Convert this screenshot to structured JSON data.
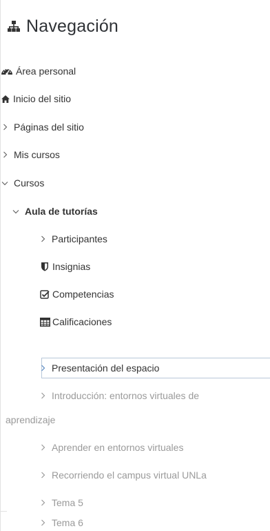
{
  "nav": {
    "title": "Navegación",
    "title_icon": "sitemap-icon",
    "items": [
      {
        "label": "Área personal",
        "icon": "dashboard-icon"
      },
      {
        "label": "Inicio del sitio",
        "icon": "home-icon"
      },
      {
        "label": "Páginas del sitio",
        "icon": "chevron-right-icon"
      },
      {
        "label": "Mis cursos",
        "icon": "chevron-right-icon"
      },
      {
        "label": "Cursos",
        "icon": "chevron-down-icon"
      },
      {
        "label": "Aula de tutorías",
        "icon": "chevron-down-icon"
      },
      {
        "label": "Participantes",
        "icon": "chevron-right-icon"
      },
      {
        "label": "Insignias",
        "icon": "shield-icon"
      },
      {
        "label": "Competencias",
        "icon": "checkbox-icon"
      },
      {
        "label": "Calificaciones",
        "icon": "table-icon"
      },
      {
        "label": "Presentación del espacio",
        "icon": "chevron-right-icon"
      },
      {
        "label": "Introducción: entornos virtuales de",
        "icon": "chevron-right-icon"
      },
      {
        "label": "aprendizaje"
      },
      {
        "label": "Aprender en entornos virtuales",
        "icon": "chevron-right-icon"
      },
      {
        "label": "Recorriendo el campus virtual UNLa",
        "icon": "chevron-right-icon"
      },
      {
        "label": "Tema 5",
        "icon": "chevron-right-icon"
      },
      {
        "label": "Tema 6",
        "icon": "chevron-right-icon"
      }
    ]
  },
  "colors": {
    "text": "#333333",
    "muted": "#9a9a9a",
    "current_border": "#b8c7d9"
  }
}
